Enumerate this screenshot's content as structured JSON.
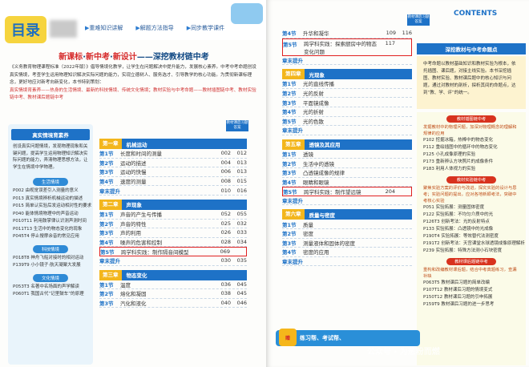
{
  "left": {
    "logo": "目录",
    "tabs": [
      "重难知识讲解",
      "解题方法指导",
      "同步教学课件"
    ],
    "slogan": {
      "p1": "新课标",
      "sep": "·",
      "p2": "新中考",
      "p3": "新设计",
      "tail": "——深挖教材链中考"
    },
    "intro": "《义务教育物理课程标准（2022年版）》倡导情境化教学，让学生在问题解决中提升能力，发展核心素养。中考中考命题创设真实情境，考查学生运用物理知识解决实际问题的能力，实现立德树人、服务选才、引导教学的核心功能。为贯彻新课标理念，更好地应对新考向新变化，本书特别策划：",
    "intro_red": "真实情境育素养——热身的生活情境、最新的科技情境、传统文化情境；教材实验与中考命题——教材插图链中考、教材实验链中考、教材课后题链中考",
    "box_header": "真实情境育素养",
    "box_text": "创设真实问题情境，发现物理现象和关键问题，提高学生运用物理知识解决实际问题的能力，弄清物理思想方法，让学生在情境中学物理。",
    "pill1": "生活情境",
    "life": [
      "P002 由视觉误差引入测量的意义",
      "P013 真实情境辨析机械运动的描述",
      "P015 简单认实验后发运动相对性的要求",
      "P040 能体情境物理中的声音运动",
      "P010T11 利用鼓掌律认识测声测时间",
      "P011T13 生活中的物态变化的现象",
      "P045T4 停止搜摩余音的常见应用"
    ],
    "pill2": "科技情境",
    "tech": [
      "P018T8 神舟飞船对接时的相对运动",
      "P139T9 小小镜子·航天凝聚大发展"
    ],
    "pill3": "文化情境",
    "culture": [
      "P053T3 名著中名场面的声学解读",
      "P060T1 我国古代“记里鼓车”的原理"
    ],
    "badge": "教材课后习题答案",
    "toc": [
      {
        "chap": "第一章",
        "title": "机械运动",
        "rows": [
          {
            "s": "第1节",
            "n": "长度和时间的测量",
            "p1": "002",
            "p2": "012"
          },
          {
            "s": "第2节",
            "n": "运动的描述",
            "p1": "004",
            "p2": "013"
          },
          {
            "s": "第3节",
            "n": "运动的快慢",
            "p1": "006",
            "p2": "013"
          },
          {
            "s": "第4节",
            "n": "速度的测量",
            "p1": "008",
            "p2": "015"
          },
          {
            "s": "章末提升",
            "n": "",
            "p1": "010",
            "p2": "016",
            "tip": true
          }
        ]
      },
      {
        "chap": "第二章",
        "title": "声现象",
        "rows": [
          {
            "s": "第1节",
            "n": "声音的产生与传播",
            "p1": "052",
            "p2": "055"
          },
          {
            "s": "第2节",
            "n": "声音的特性",
            "p1": "025",
            "p2": "032"
          },
          {
            "s": "第3节",
            "n": "声的利用",
            "p1": "026",
            "p2": "033"
          },
          {
            "s": "第4节",
            "n": "噪声的危害和控制",
            "p1": "028",
            "p2": "034"
          },
          {
            "s": "第5节",
            "n": "跨学科实践：制作隔音间模型",
            "p1": "069",
            "p2": "",
            "hl": true
          },
          {
            "s": "章末提升",
            "n": "",
            "p1": "030",
            "p2": "035",
            "tip": true
          }
        ]
      },
      {
        "chap": "第三章",
        "title": "物态变化",
        "rows": [
          {
            "s": "第1节",
            "n": "温度",
            "p1": "036",
            "p2": "045"
          },
          {
            "s": "第2节",
            "n": "熔化和凝固",
            "p1": "038",
            "p2": "045"
          },
          {
            "s": "第3节",
            "n": "汽化和液化",
            "p1": "040",
            "p2": "046"
          }
        ]
      }
    ]
  },
  "right": {
    "contents": "CONTENTS",
    "badge": "教材课后习题答案",
    "toc_top": [
      {
        "s": "第4节",
        "n": "升华和凝华",
        "p1": "109",
        "p2": "116"
      },
      {
        "s": "第5节",
        "n": "跨学科实践：探索厨房中的物态变化问题",
        "p1": "117",
        "p2": "",
        "hl": true,
        "big": true
      },
      {
        "s": "章末提升",
        "n": "",
        "p1": "",
        "p2": "",
        "tip": true
      }
    ],
    "toc": [
      {
        "chap": "第四章",
        "title": "光现象",
        "rows": [
          {
            "s": "第1节",
            "n": "光的直线传播",
            "p1": "",
            "p2": ""
          },
          {
            "s": "第2节",
            "n": "光的反射",
            "p1": "",
            "p2": ""
          },
          {
            "s": "第3节",
            "n": "平面镜成像",
            "p1": "",
            "p2": ""
          },
          {
            "s": "第4节",
            "n": "光的折射",
            "p1": "",
            "p2": ""
          },
          {
            "s": "第5节",
            "n": "光的色散",
            "p1": "",
            "p2": ""
          },
          {
            "s": "章末提升",
            "n": "",
            "p1": "",
            "p2": "",
            "tip": true
          }
        ]
      },
      {
        "chap": "第五章",
        "title": "透镜及其应用",
        "rows": [
          {
            "s": "第1节",
            "n": "透镜",
            "p1": "",
            "p2": ""
          },
          {
            "s": "第2节",
            "n": "生活中的透镜",
            "p1": "",
            "p2": ""
          },
          {
            "s": "第3节",
            "n": "凸透镜成像的规律",
            "p1": "",
            "p2": ""
          },
          {
            "s": "第4节",
            "n": "眼睛和眼镜",
            "p1": "",
            "p2": ""
          },
          {
            "s": "第5节",
            "n": "跨学科实践：制作望远镜",
            "p1": "204",
            "p2": "",
            "hl": true
          },
          {
            "s": "章末提升",
            "n": "",
            "p1": "",
            "p2": "",
            "tip": true
          }
        ]
      },
      {
        "chap": "第六章",
        "title": "质量与密度",
        "rows": [
          {
            "s": "第1节",
            "n": "质量",
            "p1": "",
            "p2": ""
          },
          {
            "s": "第2节",
            "n": "密度",
            "p1": "",
            "p2": ""
          },
          {
            "s": "第3节",
            "n": "测量液体和固体的密度",
            "p1": "",
            "p2": ""
          },
          {
            "s": "第4节",
            "n": "密度的应用",
            "p1": "",
            "p2": ""
          },
          {
            "s": "章末提升",
            "n": "",
            "p1": "",
            "p2": "",
            "tip": true
          }
        ]
      }
    ],
    "side_header": "深挖教材与中考命题点",
    "side_text": "中考命题以教材基础知识和教材实验为根本，依托插图、课后题，对接主线实验。本书深挖插图、教材实验、教材课后题中的核心知识与问题，通过对教材的剖析，探析其间的命题点，达到“教、学、评”的统一。",
    "pill1": "教材插图链中考",
    "txt1": "发掘教材中的物理问题，加深对物理概念的理解和规律的应用",
    "fig": [
      "P102 挖掘冰箱，热棒中的物态变化",
      "P112 重绘插图中的循环中的物态变化",
      "P125 小孔成像原理的实验",
      "P173 重新辨认方块照片的成像条件",
      "P183 利用人体视力的实验"
    ],
    "pill2": "教材实验链中考",
    "txt2": "聚焦实验方案的评价与改进，探究实验的设计与思考；实验问题的提出，应对各地新颖考法，突破中考核心实验",
    "exp": [
      "P051 实验拓展：测量固体密度",
      "P122 实验拓展：不均匀介质中的光",
      "P126T3 创新考法：光的反射特点",
      "P133 实验拓展：凸透镜中的光成像",
      "P190T4 实验拓展：等效替代法测密度",
      "P191T2 创新考法：天宫课堂水球透镜成像原理解析",
      "P239 实验拓展：特殊方法测小石块密度"
    ],
    "pill3": "教材课后题链中考",
    "txt3": "重构和改编教材课后题，结合中考真题练习，查漏补缺",
    "hw": [
      "P063T5 教材课后习题的简单改编",
      "P107T12 教材课后习题的情境变式",
      "P150T12 教材课后习题的引申拓展",
      "P159T9 教材课后习题的进一步思考"
    ],
    "banner": "练习帮、考试帮、",
    "gift": "赠",
    "watermark": "公众号 · 为葱粉而燃"
  }
}
